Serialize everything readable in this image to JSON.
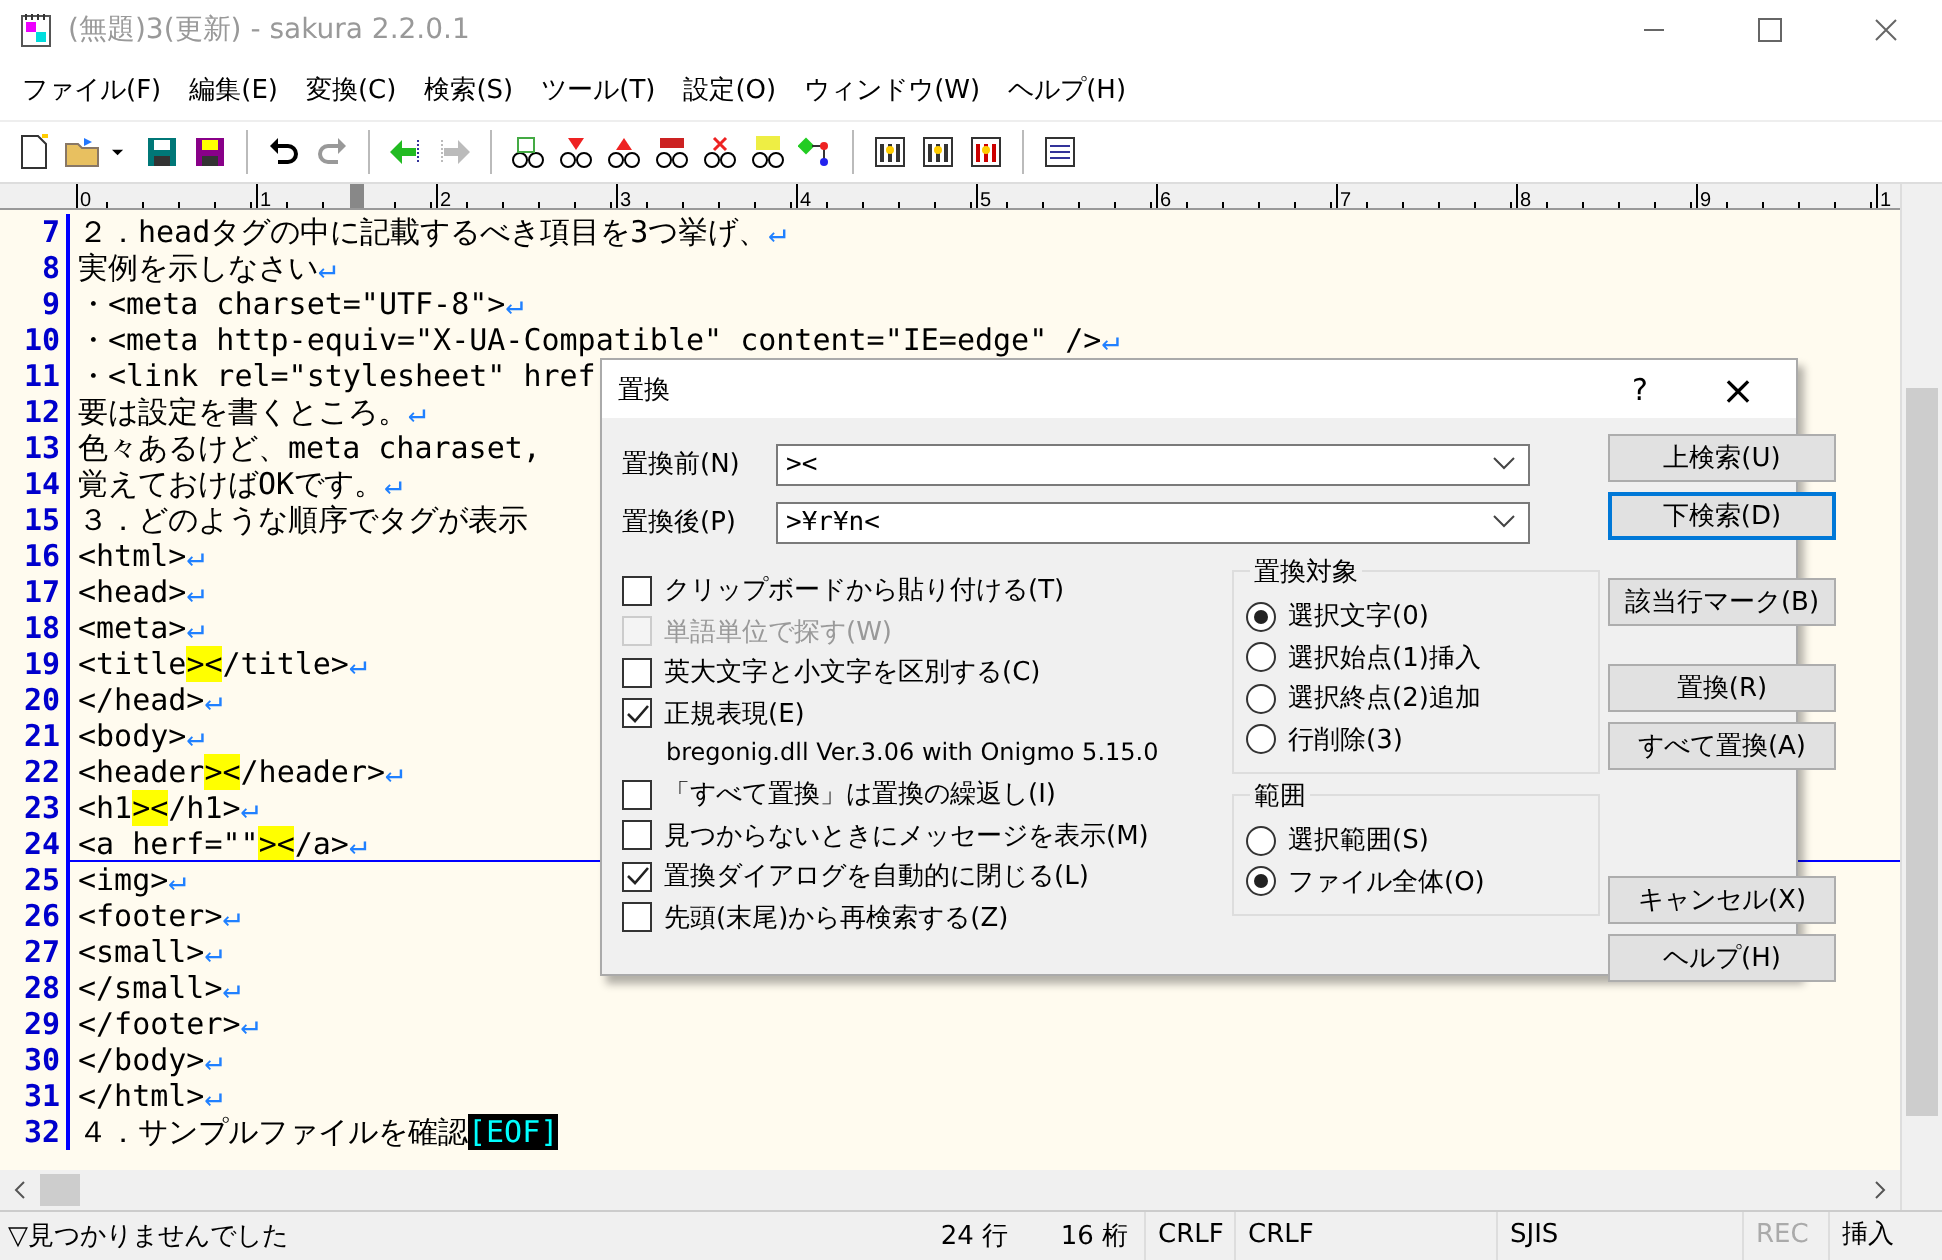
{
  "window": {
    "title": "(無題)3(更新) - sakura 2.2.0.1"
  },
  "menu": [
    "ファイル(F)",
    "編集(E)",
    "変換(C)",
    "検索(S)",
    "ツール(T)",
    "設定(O)",
    "ウィンドウ(W)",
    "ヘルプ(H)"
  ],
  "ruler": {
    "labels": [
      "0",
      "1",
      "2",
      "3",
      "4",
      "5",
      "6",
      "7",
      "8",
      "9",
      "1"
    ]
  },
  "editor": {
    "lines": [
      {
        "number": "7",
        "current": false,
        "segments": [
          {
            "kind": "text",
            "text": "２．headタグの中に記載するべき項目を3つ挙げ、"
          },
          {
            "kind": "eol",
            "text": "↵"
          }
        ]
      },
      {
        "number": "8",
        "current": false,
        "segments": [
          {
            "kind": "text",
            "text": "実例を示しなさい"
          },
          {
            "kind": "eol",
            "text": "↵"
          }
        ]
      },
      {
        "number": "9",
        "current": false,
        "segments": [
          {
            "kind": "text",
            "text": "・<meta charset=\"UTF-8\">"
          },
          {
            "kind": "eol",
            "text": "↵"
          }
        ]
      },
      {
        "number": "10",
        "current": false,
        "segments": [
          {
            "kind": "text",
            "text": "・<meta http-equiv=\"X-UA-Compatible\" content=\"IE=edge\" />"
          },
          {
            "kind": "eol",
            "text": "↵"
          }
        ]
      },
      {
        "number": "11",
        "current": false,
        "segments": [
          {
            "kind": "text",
            "text": "・<link rel=\"stylesheet\" href"
          }
        ]
      },
      {
        "number": "12",
        "current": false,
        "segments": [
          {
            "kind": "text",
            "text": "要は設定を書くところ。"
          },
          {
            "kind": "eol",
            "text": "↵"
          }
        ]
      },
      {
        "number": "13",
        "current": false,
        "segments": [
          {
            "kind": "text",
            "text": "色々あるけど、meta charaset,"
          }
        ]
      },
      {
        "number": "14",
        "current": false,
        "segments": [
          {
            "kind": "text",
            "text": "覚えておけばOKです。"
          },
          {
            "kind": "eol",
            "text": "↵"
          }
        ]
      },
      {
        "number": "15",
        "current": false,
        "segments": [
          {
            "kind": "text",
            "text": "３．どのような順序でタグが表示"
          }
        ]
      },
      {
        "number": "16",
        "current": false,
        "segments": [
          {
            "kind": "text",
            "text": "<html>"
          },
          {
            "kind": "eol",
            "text": "↵"
          }
        ]
      },
      {
        "number": "17",
        "current": false,
        "segments": [
          {
            "kind": "text",
            "text": "<head>"
          },
          {
            "kind": "eol",
            "text": "↵"
          }
        ]
      },
      {
        "number": "18",
        "current": false,
        "segments": [
          {
            "kind": "text",
            "text": "<meta>"
          },
          {
            "kind": "eol",
            "text": "↵"
          }
        ]
      },
      {
        "number": "19",
        "current": false,
        "segments": [
          {
            "kind": "text",
            "text": "<title"
          },
          {
            "kind": "match",
            "text": "><"
          },
          {
            "kind": "text",
            "text": "/title>"
          },
          {
            "kind": "eol",
            "text": "↵"
          }
        ]
      },
      {
        "number": "20",
        "current": false,
        "segments": [
          {
            "kind": "text",
            "text": "</head>"
          },
          {
            "kind": "eol",
            "text": "↵"
          }
        ]
      },
      {
        "number": "21",
        "current": false,
        "segments": [
          {
            "kind": "text",
            "text": "<body>"
          },
          {
            "kind": "eol",
            "text": "↵"
          }
        ]
      },
      {
        "number": "22",
        "current": false,
        "segments": [
          {
            "kind": "text",
            "text": "<header"
          },
          {
            "kind": "match",
            "text": "><"
          },
          {
            "kind": "text",
            "text": "/header>"
          },
          {
            "kind": "eol",
            "text": "↵"
          }
        ]
      },
      {
        "number": "23",
        "current": false,
        "segments": [
          {
            "kind": "text",
            "text": "<h1"
          },
          {
            "kind": "match",
            "text": "><"
          },
          {
            "kind": "text",
            "text": "/h1>"
          },
          {
            "kind": "eol",
            "text": "↵"
          }
        ]
      },
      {
        "number": "24",
        "current": true,
        "segments": [
          {
            "kind": "text",
            "text": "<a herf=\"\""
          },
          {
            "kind": "match",
            "text": "><"
          },
          {
            "kind": "text",
            "text": "/a>"
          },
          {
            "kind": "eol",
            "text": "↵"
          }
        ]
      },
      {
        "number": "25",
        "current": false,
        "segments": [
          {
            "kind": "text",
            "text": "<img>"
          },
          {
            "kind": "eol",
            "text": "↵"
          }
        ]
      },
      {
        "number": "26",
        "current": false,
        "segments": [
          {
            "kind": "text",
            "text": "<footer>"
          },
          {
            "kind": "eol",
            "text": "↵"
          }
        ]
      },
      {
        "number": "27",
        "current": false,
        "segments": [
          {
            "kind": "text",
            "text": "<small>"
          },
          {
            "kind": "eol",
            "text": "↵"
          }
        ]
      },
      {
        "number": "28",
        "current": false,
        "segments": [
          {
            "kind": "text",
            "text": "</small>"
          },
          {
            "kind": "eol",
            "text": "↵"
          }
        ]
      },
      {
        "number": "29",
        "current": false,
        "segments": [
          {
            "kind": "text",
            "text": "</footer>"
          },
          {
            "kind": "eol",
            "text": "↵"
          }
        ]
      },
      {
        "number": "30",
        "current": false,
        "segments": [
          {
            "kind": "text",
            "text": "</body>"
          },
          {
            "kind": "eol",
            "text": "↵"
          }
        ]
      },
      {
        "number": "31",
        "current": false,
        "segments": [
          {
            "kind": "text",
            "text": "</html>"
          },
          {
            "kind": "eol",
            "text": "↵"
          }
        ]
      },
      {
        "number": "32",
        "current": false,
        "segments": [
          {
            "kind": "text",
            "text": "４．サンプルファイルを確認"
          },
          {
            "kind": "eof",
            "text": "[EOF]"
          }
        ]
      }
    ]
  },
  "dialog": {
    "title": "置換",
    "help": "?",
    "close": "×",
    "fields": [
      {
        "label": "置換前(N)",
        "value": "><"
      },
      {
        "label": "置換後(P)",
        "value": ">¥r¥n<"
      }
    ],
    "options": [
      {
        "kind": "checkbox",
        "label": "クリップボードから貼り付ける(T)",
        "checked": false,
        "disabled": false
      },
      {
        "kind": "checkbox",
        "label": "単語単位で探す(W)",
        "checked": false,
        "disabled": true
      },
      {
        "kind": "checkbox",
        "label": "英大文字と小文字を区別する(C)",
        "checked": false,
        "disabled": false
      },
      {
        "kind": "checkbox",
        "label": "正規表現(E)",
        "checked": true,
        "disabled": false
      },
      {
        "kind": "note",
        "label": "bregonig.dll Ver.3.06 with Onigmo 5.15.0"
      },
      {
        "kind": "checkbox",
        "label": "「すべて置換」は置換の繰返し(I)",
        "checked": false,
        "disabled": false
      },
      {
        "kind": "checkbox",
        "label": "見つからないときにメッセージを表示(M)",
        "checked": false,
        "disabled": false
      },
      {
        "kind": "checkbox",
        "label": "置換ダイアログを自動的に閉じる(L)",
        "checked": true,
        "disabled": false
      },
      {
        "kind": "checkbox",
        "label": "先頭(末尾)から再検索する(Z)",
        "checked": false,
        "disabled": false
      }
    ],
    "groups": [
      {
        "title": "置換対象",
        "options": [
          {
            "label": "選択文字(0)",
            "selected": true
          },
          {
            "label": "選択始点(1)挿入",
            "selected": false
          },
          {
            "label": "選択終点(2)追加",
            "selected": false
          },
          {
            "label": "行削除(3)",
            "selected": false
          }
        ]
      },
      {
        "title": "範囲",
        "options": [
          {
            "label": "選択範囲(S)",
            "selected": false
          },
          {
            "label": "ファイル全体(O)",
            "selected": true
          }
        ]
      }
    ],
    "buttons": [
      {
        "label": "上検索(U)",
        "default": false
      },
      {
        "label": "下検索(D)",
        "default": true
      },
      {
        "label": "該当行マーク(B)",
        "default": false
      },
      {
        "label": "置換(R)",
        "default": false
      },
      {
        "label": "すべて置換(A)",
        "default": false
      },
      {
        "label": "キャンセル(X)",
        "default": false
      },
      {
        "label": "ヘルプ(H)",
        "default": false
      }
    ]
  },
  "status_bar": {
    "message": "▽見つかりませんでした",
    "line": "24 行",
    "column": "16 桁",
    "cells": [
      {
        "text": "CRLF",
        "disabled": false
      },
      {
        "text": "CRLF",
        "disabled": false
      },
      {
        "text": "SJIS",
        "disabled": false
      },
      {
        "text": "REC",
        "disabled": true
      },
      {
        "text": "挿入",
        "disabled": false
      }
    ]
  }
}
